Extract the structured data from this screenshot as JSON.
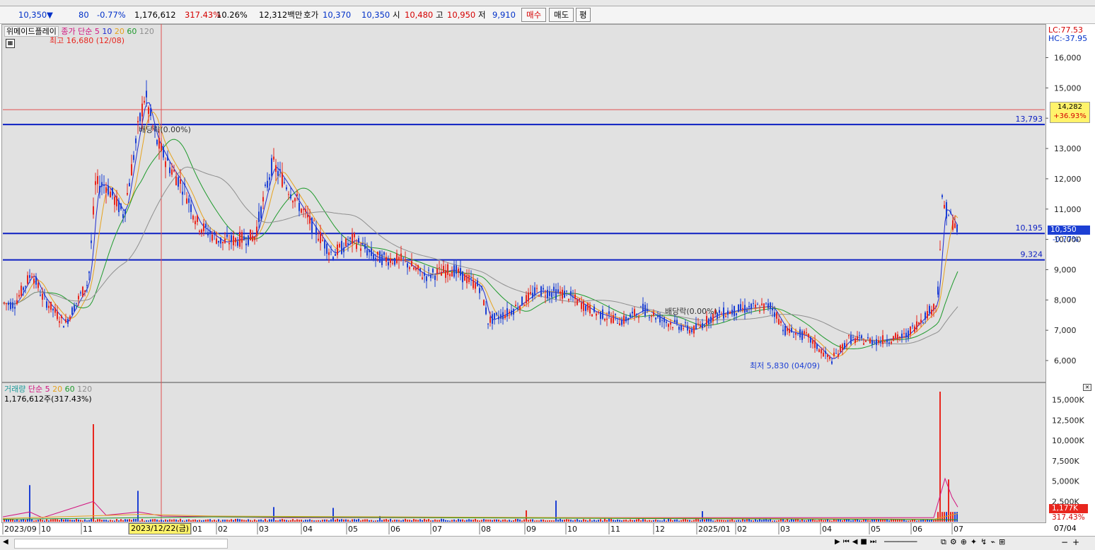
{
  "quote": {
    "price": "10,350",
    "arrow": "▼",
    "change": "80",
    "change_pct": "-0.77%",
    "volume": "1,176,612",
    "vol_ratio": "317.43%",
    "turnover": "10.26%",
    "amount": "12,312백만",
    "bid_label": "호가",
    "bid1": "10,370",
    "bid2": "10,350",
    "open_label": "시",
    "open": "10,480",
    "high_label": "고",
    "high": "10,950",
    "low_label": "저",
    "low": "9,910",
    "buy_label": "매수",
    "sell_label": "매도",
    "extra_label": "평"
  },
  "price_panel": {
    "stock_name": "위메이드플레이",
    "ma_title": "종가 단순",
    "ma_periods": [
      "5",
      "10",
      "20",
      "60",
      "120"
    ],
    "lc": "LC:77.53",
    "hc": "HC:-37.95",
    "high_note": "최고 16,680 (12/08)",
    "low_note": "최저 5,830 (04/09)",
    "div_note1": "배당락(0.00%)",
    "div_note2": "배당락(0.00%)",
    "line1": "13,793",
    "line2": "10,195",
    "line3": "9,324",
    "current": "10,350",
    "current_pct": "-0.77%",
    "cross_price": "14,282",
    "cross_pct": "+36.93%",
    "y_ticks": [
      "16,000",
      "15,000",
      "14,000",
      "13,000",
      "12,000",
      "11,000",
      "10,000",
      "9,000",
      "8,000",
      "7,000",
      "6,000"
    ]
  },
  "volume_panel": {
    "title": "거래량",
    "ma_title": "단순",
    "ma_periods": [
      "5",
      "20",
      "60",
      "120"
    ],
    "value": "1,176,612주(317.43%)",
    "current": "1,177K",
    "current_pct": "317.43%",
    "y_ticks": [
      "15,000K",
      "12,500K",
      "10,000K",
      "7,500K",
      "5,000K",
      "2,500K"
    ]
  },
  "x_axis": {
    "labels": [
      "2023/09",
      "10",
      "11",
      "12",
      "01",
      "02",
      "03",
      "04",
      "05",
      "06",
      "07",
      "08",
      "09",
      "10",
      "11",
      "12",
      "2025/01",
      "02",
      "03",
      "04",
      "05",
      "06",
      "07"
    ],
    "cursor_date": "2023/12/22(금)",
    "end_date": "07/04"
  },
  "colors": {
    "up": "#e8261e",
    "down": "#1c3fd4",
    "ma5": "#d2137f",
    "ma10": "#1f2bd0",
    "ma20": "#e6a21d",
    "ma60": "#1e9a2c",
    "ma120": "#8f8f8f",
    "hline": "#0c1fc2"
  }
}
